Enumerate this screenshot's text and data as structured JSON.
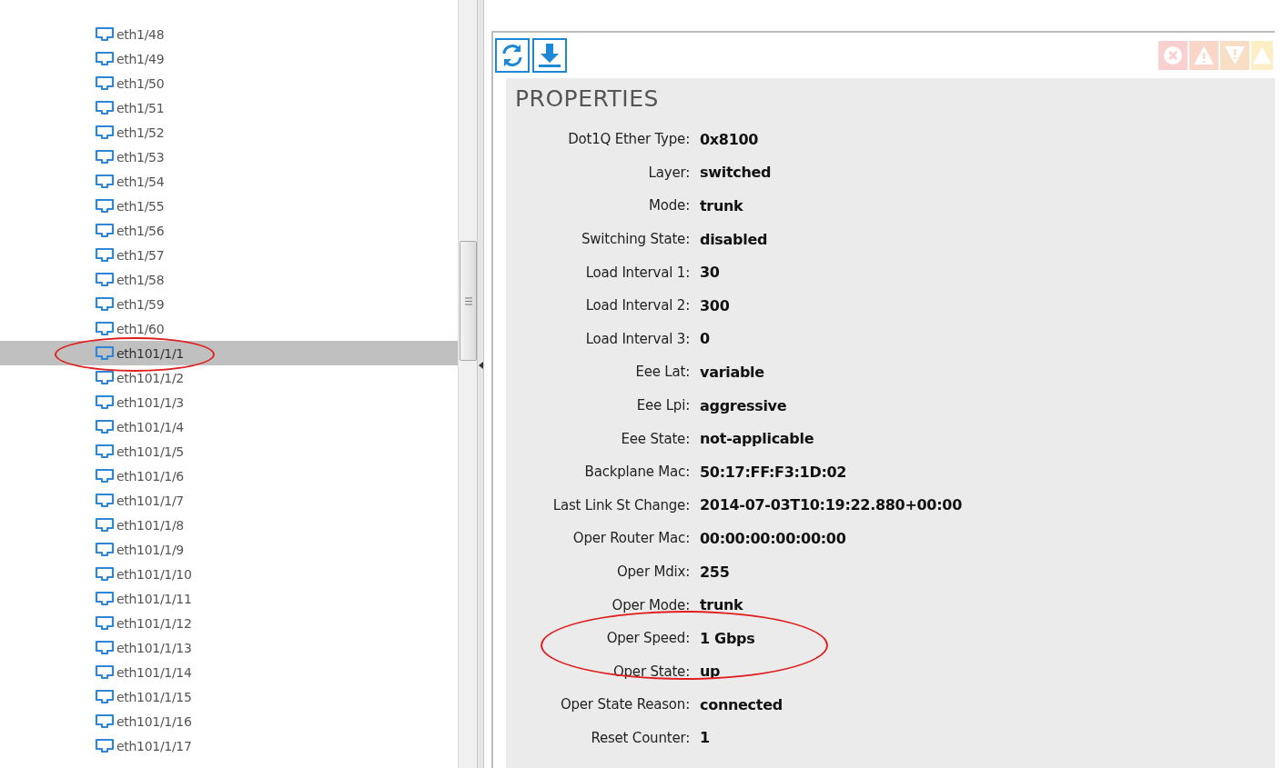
{
  "interfaces": [
    {
      "label": "eth1/48",
      "selected": false
    },
    {
      "label": "eth1/49",
      "selected": false
    },
    {
      "label": "eth1/50",
      "selected": false
    },
    {
      "label": "eth1/51",
      "selected": false
    },
    {
      "label": "eth1/52",
      "selected": false
    },
    {
      "label": "eth1/53",
      "selected": false
    },
    {
      "label": "eth1/54",
      "selected": false
    },
    {
      "label": "eth1/55",
      "selected": false
    },
    {
      "label": "eth1/56",
      "selected": false
    },
    {
      "label": "eth1/57",
      "selected": false
    },
    {
      "label": "eth1/58",
      "selected": false
    },
    {
      "label": "eth1/59",
      "selected": false
    },
    {
      "label": "eth1/60",
      "selected": false
    },
    {
      "label": "eth101/1/1",
      "selected": true
    },
    {
      "label": "eth101/1/2",
      "selected": false
    },
    {
      "label": "eth101/1/3",
      "selected": false
    },
    {
      "label": "eth101/1/4",
      "selected": false
    },
    {
      "label": "eth101/1/5",
      "selected": false
    },
    {
      "label": "eth101/1/6",
      "selected": false
    },
    {
      "label": "eth101/1/7",
      "selected": false
    },
    {
      "label": "eth101/1/8",
      "selected": false
    },
    {
      "label": "eth101/1/9",
      "selected": false
    },
    {
      "label": "eth101/1/10",
      "selected": false
    },
    {
      "label": "eth101/1/11",
      "selected": false
    },
    {
      "label": "eth101/1/12",
      "selected": false
    },
    {
      "label": "eth101/1/13",
      "selected": false
    },
    {
      "label": "eth101/1/14",
      "selected": false
    },
    {
      "label": "eth101/1/15",
      "selected": false
    },
    {
      "label": "eth101/1/16",
      "selected": false
    },
    {
      "label": "eth101/1/17",
      "selected": false
    }
  ],
  "properties": {
    "title": "PROPERTIES",
    "rows": [
      {
        "label": "Dot1Q Ether Type:",
        "value": "0x8100"
      },
      {
        "label": "Layer:",
        "value": "switched"
      },
      {
        "label": "Mode:",
        "value": "trunk"
      },
      {
        "label": "Switching State:",
        "value": "disabled"
      },
      {
        "label": "Load Interval 1:",
        "value": "30"
      },
      {
        "label": "Load Interval 2:",
        "value": "300"
      },
      {
        "label": "Load Interval 3:",
        "value": "0"
      },
      {
        "label": "Eee Lat:",
        "value": "variable"
      },
      {
        "label": "Eee Lpi:",
        "value": "aggressive"
      },
      {
        "label": "Eee State:",
        "value": "not-applicable"
      },
      {
        "label": "Backplane Mac:",
        "value": "50:17:FF:F3:1D:02"
      },
      {
        "label": "Last Link St Change:",
        "value": "2014-07-03T10:19:22.880+00:00"
      },
      {
        "label": "Oper Router Mac:",
        "value": "00:00:00:00:00:00"
      },
      {
        "label": "Oper Mdix:",
        "value": "255"
      },
      {
        "label": "Oper Mode:",
        "value": "trunk"
      },
      {
        "label": "Oper Speed:",
        "value": "1 Gbps"
      },
      {
        "label": "Oper State:",
        "value": "up"
      },
      {
        "label": "Oper State Reason:",
        "value": "connected"
      },
      {
        "label": "Reset Counter:",
        "value": "1"
      }
    ]
  }
}
